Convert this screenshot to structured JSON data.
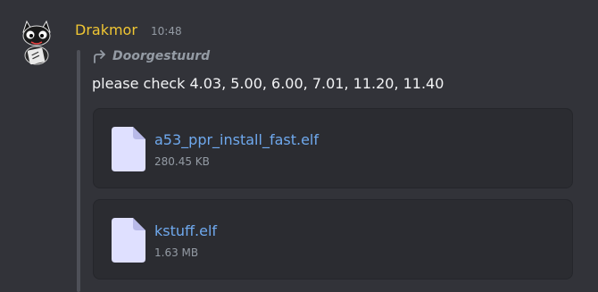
{
  "message": {
    "author": "Drakmor",
    "timestamp": "10:48",
    "author_color": "#f0c633",
    "forwarded_label": "Doorgestuurd",
    "text": "please check 4.03, 5.00, 6.00, 7.01, 11.20, 11.40",
    "attachments": [
      {
        "name": "a53_ppr_install_fast.elf",
        "size": "280.45 KB",
        "icon": "file-icon"
      },
      {
        "name": "kstuff.elf",
        "size": "1.63 MB",
        "icon": "file-icon"
      }
    ]
  },
  "colors": {
    "background": "#323339",
    "attachment_bg": "#2b2c31",
    "link": "#6fa9ee",
    "muted": "#949ba4",
    "file_icon": "#dfe0ff"
  }
}
